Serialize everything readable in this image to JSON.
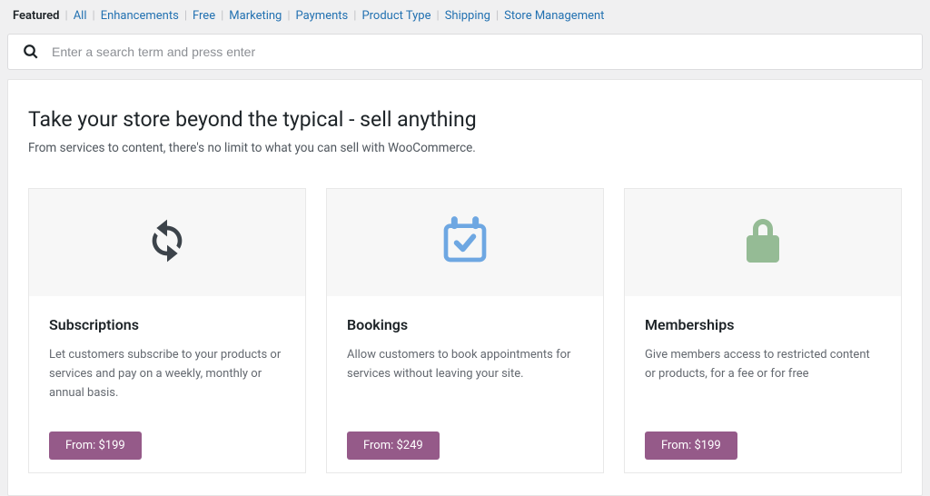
{
  "nav": {
    "tabs": [
      {
        "label": "Featured",
        "active": true
      },
      {
        "label": "All",
        "active": false
      },
      {
        "label": "Enhancements",
        "active": false
      },
      {
        "label": "Free",
        "active": false
      },
      {
        "label": "Marketing",
        "active": false
      },
      {
        "label": "Payments",
        "active": false
      },
      {
        "label": "Product Type",
        "active": false
      },
      {
        "label": "Shipping",
        "active": false
      },
      {
        "label": "Store Management",
        "active": false
      }
    ]
  },
  "search": {
    "placeholder": "Enter a search term and press enter",
    "value": ""
  },
  "hero": {
    "title": "Take your store beyond the typical - sell anything",
    "subtitle": "From services to content, there's no limit to what you can sell with WooCommerce."
  },
  "cards": [
    {
      "icon": "refresh-icon",
      "title": "Subscriptions",
      "description": "Let customers subscribe to your products or services and pay on a weekly, monthly or annual basis.",
      "button": "From: $199"
    },
    {
      "icon": "calendar-check-icon",
      "title": "Bookings",
      "description": "Allow customers to book appointments for services without leaving your site.",
      "button": "From: $249"
    },
    {
      "icon": "lock-icon",
      "title": "Memberships",
      "description": "Give members access to restricted content or products, for a fee or for free",
      "button": "From: $199"
    }
  ],
  "colors": {
    "link": "#2271b1",
    "button": "#955a89",
    "icon_gray": "#3c434a",
    "icon_blue": "#6ea7e2",
    "icon_green": "#95bb95"
  }
}
